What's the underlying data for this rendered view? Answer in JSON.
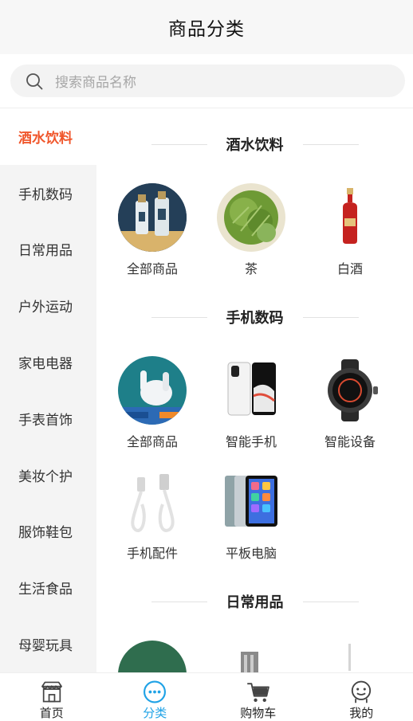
{
  "header": {
    "title": "商品分类"
  },
  "search": {
    "placeholder": "搜索商品名称"
  },
  "sidebar": {
    "items": [
      {
        "label": "酒水饮料",
        "active": true
      },
      {
        "label": "手机数码"
      },
      {
        "label": "日常用品"
      },
      {
        "label": "户外运动"
      },
      {
        "label": "家电电器"
      },
      {
        "label": "手表首饰"
      },
      {
        "label": "美妆个护"
      },
      {
        "label": "服饰鞋包"
      },
      {
        "label": "生活食品"
      },
      {
        "label": "母婴玩具"
      }
    ]
  },
  "sections": [
    {
      "title": "酒水饮料",
      "items": [
        {
          "label": "全部商品"
        },
        {
          "label": "茶"
        },
        {
          "label": "白酒"
        }
      ]
    },
    {
      "title": "手机数码",
      "items": [
        {
          "label": "全部商品"
        },
        {
          "label": "智能手机"
        },
        {
          "label": "智能设备"
        },
        {
          "label": "手机配件"
        },
        {
          "label": "平板电脑"
        }
      ]
    },
    {
      "title": "日常用品",
      "items": []
    }
  ],
  "tabbar": {
    "items": [
      {
        "label": "首页",
        "icon": "store-icon"
      },
      {
        "label": "分类",
        "icon": "category-icon",
        "active": true
      },
      {
        "label": "购物车",
        "icon": "cart-icon"
      },
      {
        "label": "我的",
        "icon": "profile-icon"
      }
    ]
  },
  "colors": {
    "accent": "#f0562b",
    "tab_active": "#1fa2e6"
  }
}
